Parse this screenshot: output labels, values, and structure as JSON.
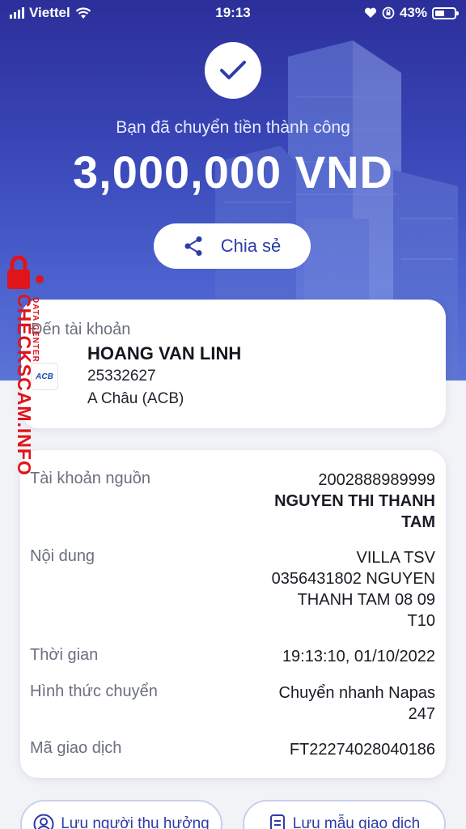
{
  "status_bar": {
    "carrier": "Viettel",
    "time": "19:13",
    "battery": "43%"
  },
  "header": {
    "success_message": "Bạn đã chuyển tiền thành công",
    "amount": "3,000,000 VND",
    "share_label": "Chia sẻ"
  },
  "recipient": {
    "label": "Đến tài khoản",
    "name": "HOANG VAN LINH",
    "account_number": "25332627",
    "bank": "A Châu (ACB)",
    "bank_logo_text": "ACB"
  },
  "details": {
    "source_account_label": "Tài khoản nguồn",
    "source_account_number": "2002888989999",
    "source_account_name_line1": "NGUYEN THI THANH",
    "source_account_name_line2": "TAM",
    "content_label": "Nội dung",
    "content_line1": "VILLA TSV",
    "content_line2": "0356431802 NGUYEN",
    "content_line3": "THANH TAM 08 09",
    "content_line4": "T10",
    "time_label": "Thời gian",
    "time_value": "19:13:10, 01/10/2022",
    "method_label": "Hình thức chuyển",
    "method_line1": "Chuyển nhanh Napas",
    "method_line2": "247",
    "txn_label": "Mã giao dịch",
    "txn_value": "FT22274028040186"
  },
  "actions": {
    "save_recipient": "Lưu người thụ hưởng",
    "save_template": "Lưu mẫu giao dịch"
  },
  "watermark": {
    "big_text": "CHECKSCAM.INFO",
    "small_text": "DATA CENTER"
  },
  "colors": {
    "primary": "#2d3ca8",
    "hero_top": "#2c2f9a",
    "hero_bottom": "#5b74d6",
    "watermark": "#e0141b"
  }
}
